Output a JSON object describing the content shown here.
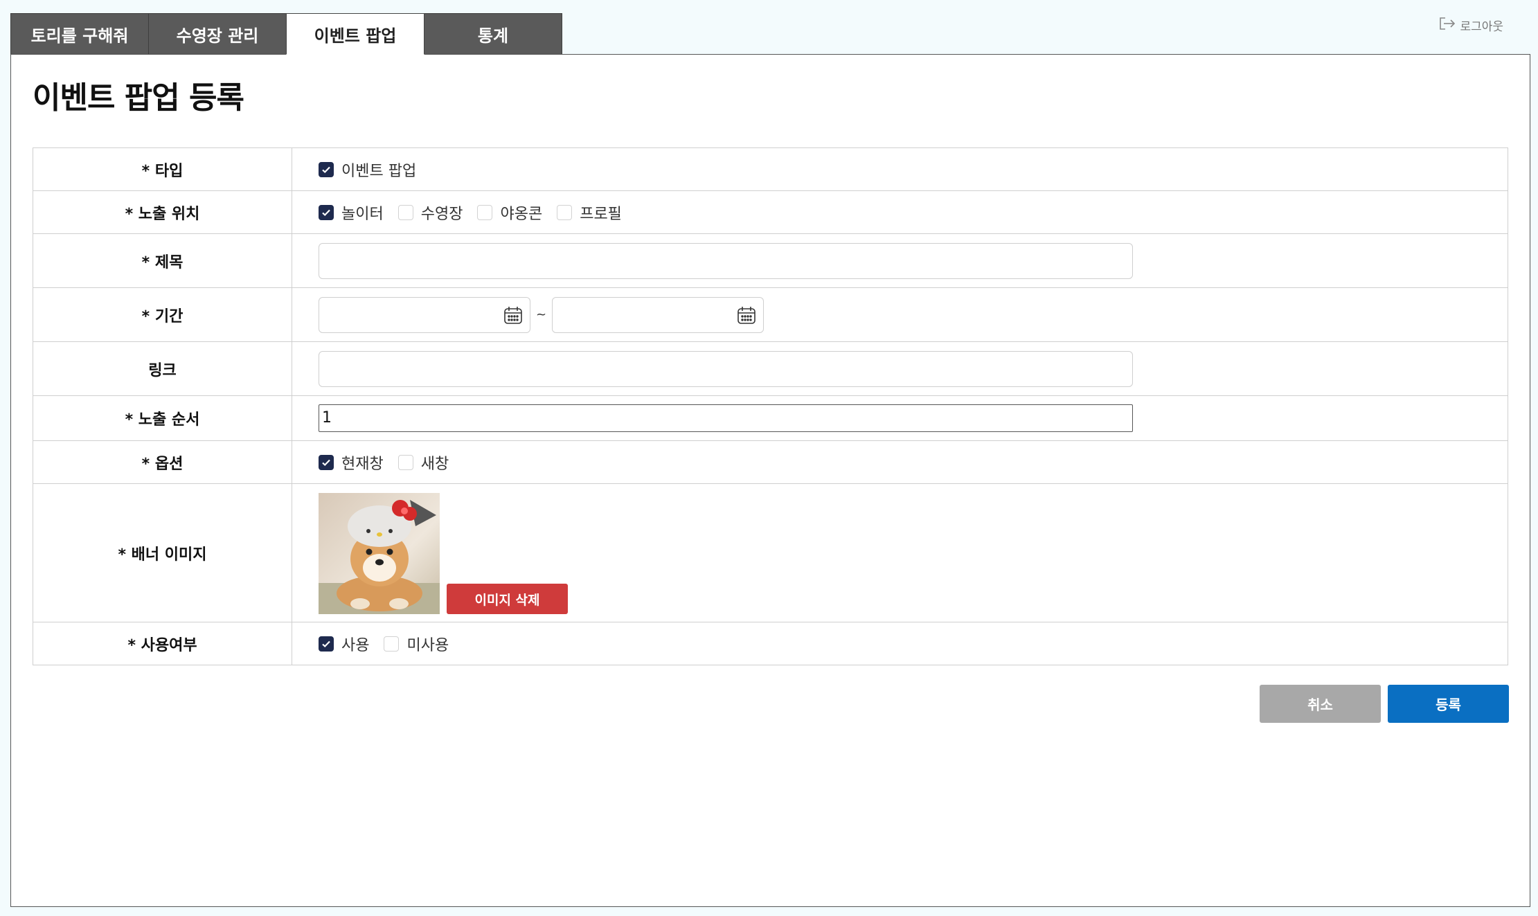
{
  "tabs": [
    {
      "label": "토리를 구해줘",
      "active": false
    },
    {
      "label": "수영장 관리",
      "active": false
    },
    {
      "label": "이벤트 팝업",
      "active": true
    },
    {
      "label": "통계",
      "active": false
    }
  ],
  "logout_label": "로그아웃",
  "page_title": "이벤트 팝업 등록",
  "form": {
    "type": {
      "label": "* 타입",
      "options": [
        {
          "label": "이벤트 팝업",
          "checked": true
        }
      ]
    },
    "exposure_location": {
      "label": "* 노출 위치",
      "options": [
        {
          "label": "놀이터",
          "checked": true
        },
        {
          "label": "수영장",
          "checked": false
        },
        {
          "label": "야옹콘",
          "checked": false
        },
        {
          "label": "프로필",
          "checked": false
        }
      ]
    },
    "title": {
      "label": "* 제목",
      "value": ""
    },
    "period": {
      "label": "* 기간",
      "start": "",
      "end": "",
      "separator": "~"
    },
    "link": {
      "label": "링크",
      "value": ""
    },
    "order": {
      "label": "* 노출 순서",
      "value": "1"
    },
    "option": {
      "label": "* 옵션",
      "options": [
        {
          "label": "현재창",
          "checked": true
        },
        {
          "label": "새창",
          "checked": false
        }
      ]
    },
    "banner": {
      "label": "* 배너 이미지",
      "delete_label": "이미지 삭제"
    },
    "usage": {
      "label": "* 사용여부",
      "options": [
        {
          "label": "사용",
          "checked": true
        },
        {
          "label": "미사용",
          "checked": false
        }
      ]
    }
  },
  "buttons": {
    "cancel": "취소",
    "submit": "등록"
  },
  "colors": {
    "tab_bg": "#5a5a5a",
    "checkbox": "#1e2a4e",
    "delete": "#cf3b3b",
    "submit": "#0a6fc2",
    "cancel": "#a8a8a8"
  }
}
